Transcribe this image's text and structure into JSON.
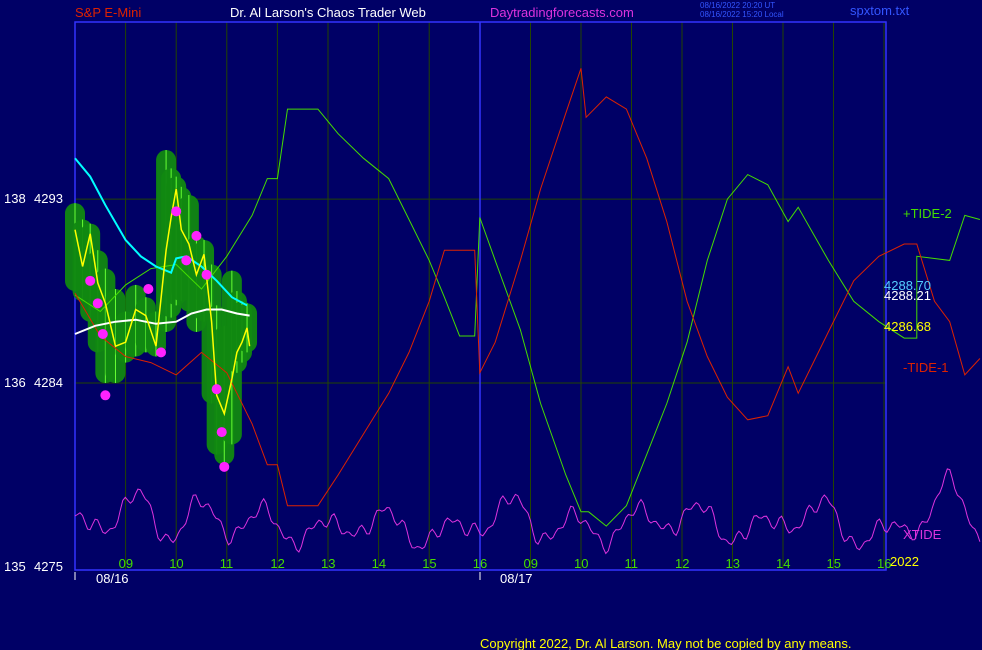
{
  "header": {
    "symbol": "S&P E-Mini",
    "author": "Dr. Al Larson's Chaos Trader Web",
    "site": "Daytradingforecasts.com",
    "timestamp_ut": "08/16/2022 20:20 UT",
    "timestamp_local": "08/16/2022 15:20 Local",
    "file": "spxtom.txt"
  },
  "footer": {
    "copyright": "Copyright 2022, Dr. Al Larson. May not be copied by any means."
  },
  "colors": {
    "background": "#000066",
    "frame": "#3333ff",
    "grid": "#224400",
    "tide_up": "#44dd00",
    "tide_down": "#dd2200",
    "xtide": "#dd33dd",
    "price_bars": "#00cc00",
    "price_line": "#ffff00",
    "ma_fast": "#00ffff",
    "ma_slow": "#ffffff"
  },
  "chart_data": {
    "type": "line",
    "y_axis_labels": [
      {
        "left": "138",
        "right": "4293",
        "value": 4293
      },
      {
        "left": "136",
        "right": "4284",
        "value": 4284
      },
      {
        "left": "135",
        "right": "4275",
        "value": 4275
      }
    ],
    "ylim": [
      4275,
      4294
    ],
    "x_ticks_day1": [
      "09",
      "10",
      "11",
      "12",
      "13",
      "14",
      "15",
      "16"
    ],
    "x_ticks_day2": [
      "09",
      "10",
      "11",
      "12",
      "13",
      "14",
      "15",
      "16"
    ],
    "date_labels": [
      "08/16",
      "08/17"
    ],
    "year_label": "2022",
    "value_labels": [
      {
        "text": "4288.70",
        "value": 4288.7,
        "color": "#55ccff"
      },
      {
        "text": "4288.21",
        "value": 4288.21,
        "color": "#ffffff"
      },
      {
        "text": "4286.68",
        "value": 4286.68,
        "color": "#ffff00"
      }
    ],
    "series_labels": [
      {
        "text": "+TIDE-2",
        "color": "#44dd00"
      },
      {
        "text": "-TIDE-1",
        "color": "#dd2200"
      },
      {
        "text": "XTIDE",
        "color": "#dd33dd"
      }
    ],
    "tide_up": [
      [
        8.0,
        4288.3
      ],
      [
        8.5,
        4287.5
      ],
      [
        9.0,
        4288.8
      ],
      [
        9.5,
        4289.6
      ],
      [
        10.0,
        4289.8
      ],
      [
        10.5,
        4288.6
      ],
      [
        11.0,
        4290.2
      ],
      [
        11.5,
        4292.2
      ],
      [
        11.8,
        4294.0
      ],
      [
        12.0,
        4294.0
      ],
      [
        12.2,
        4297.4
      ],
      [
        12.8,
        4297.4
      ],
      [
        13.2,
        4296.2
      ],
      [
        13.7,
        4295.0
      ],
      [
        14.2,
        4294.0
      ],
      [
        14.6,
        4292.0
      ],
      [
        15.0,
        4290.0
      ],
      [
        15.3,
        4288.2
      ],
      [
        15.6,
        4286.3
      ],
      [
        15.9,
        4286.3
      ],
      [
        16.0,
        4292.1
      ],
      [
        16.3,
        4290.0
      ],
      [
        16.8,
        4286.6
      ],
      [
        17.2,
        4283.0
      ],
      [
        17.7,
        4279.5
      ],
      [
        18.0,
        4277.7
      ],
      [
        18.15,
        4277.7
      ],
      [
        18.5,
        4277.0
      ],
      [
        18.9,
        4278.0
      ],
      [
        19.3,
        4280.5
      ],
      [
        19.7,
        4283.0
      ],
      [
        20.1,
        4286.0
      ],
      [
        20.5,
        4290.0
      ],
      [
        20.9,
        4293.0
      ],
      [
        21.3,
        4294.2
      ],
      [
        21.7,
        4293.7
      ],
      [
        22.1,
        4291.9
      ],
      [
        22.3,
        4292.6
      ],
      [
        22.9,
        4290.0
      ],
      [
        23.4,
        4288.0
      ],
      [
        23.9,
        4287.0
      ],
      [
        24.4,
        4286.2
      ],
      [
        24.65,
        4286.2
      ],
      [
        24.65,
        4290.2
      ],
      [
        25.3,
        4290.0
      ],
      [
        25.6,
        4292.2
      ],
      [
        25.9,
        4292.0
      ]
    ],
    "tide_down": [
      [
        8.0,
        4288.4
      ],
      [
        8.5,
        4286.3
      ],
      [
        9.0,
        4285.3
      ],
      [
        9.5,
        4285.0
      ],
      [
        10.0,
        4284.4
      ],
      [
        10.5,
        4285.5
      ],
      [
        11.0,
        4284.5
      ],
      [
        11.5,
        4282.0
      ],
      [
        11.8,
        4280.0
      ],
      [
        12.0,
        4280.0
      ],
      [
        12.2,
        4278.0
      ],
      [
        12.8,
        4278.0
      ],
      [
        13.2,
        4279.5
      ],
      [
        13.7,
        4281.5
      ],
      [
        14.2,
        4283.5
      ],
      [
        14.6,
        4285.5
      ],
      [
        15.0,
        4288.0
      ],
      [
        15.3,
        4290.5
      ],
      [
        15.9,
        4290.5
      ],
      [
        16.0,
        4284.5
      ],
      [
        16.3,
        4286.0
      ],
      [
        16.8,
        4290.0
      ],
      [
        17.2,
        4293.5
      ],
      [
        17.7,
        4297.2
      ],
      [
        18.0,
        4299.4
      ],
      [
        18.1,
        4297.0
      ],
      [
        18.5,
        4298.0
      ],
      [
        18.9,
        4297.4
      ],
      [
        19.3,
        4295.0
      ],
      [
        19.7,
        4291.9
      ],
      [
        20.1,
        4288.0
      ],
      [
        20.5,
        4285.3
      ],
      [
        20.9,
        4283.3
      ],
      [
        21.3,
        4282.2
      ],
      [
        21.7,
        4282.4
      ],
      [
        22.1,
        4284.8
      ],
      [
        22.3,
        4283.5
      ],
      [
        22.9,
        4286.5
      ],
      [
        23.4,
        4289.0
      ],
      [
        23.9,
        4290.2
      ],
      [
        24.4,
        4290.8
      ],
      [
        24.65,
        4290.8
      ],
      [
        25.0,
        4288.0
      ],
      [
        25.3,
        4287.0
      ],
      [
        25.6,
        4284.4
      ],
      [
        25.9,
        4285.2
      ]
    ],
    "xtide_levels": [
      4277.5,
      4276.8,
      4278.7,
      4276.2,
      4278.3,
      4276.5,
      4277.9,
      4276.1,
      4277.3,
      4276.6,
      4277.8,
      4276.0,
      4277.2,
      4276.7,
      4278.5,
      4276.3,
      4277.6,
      4276.1,
      4277.9,
      4276.8,
      4278.1,
      4276.2,
      4277.4,
      4276.9,
      4278.3,
      4276.0,
      4277.1,
      4276.7,
      4279.4,
      4276.4
    ],
    "price": [
      [
        8.0,
        4291.5
      ],
      [
        8.15,
        4289.7
      ],
      [
        8.3,
        4291.3
      ],
      [
        8.45,
        4288.9
      ],
      [
        8.6,
        4287.9
      ],
      [
        8.8,
        4285.8
      ],
      [
        9.0,
        4286.0
      ],
      [
        9.2,
        4287.6
      ],
      [
        9.4,
        4287.3
      ],
      [
        9.6,
        4285.8
      ],
      [
        9.8,
        4290.5
      ],
      [
        9.9,
        4292.1
      ],
      [
        10.0,
        4293.5
      ],
      [
        10.1,
        4291.5
      ],
      [
        10.25,
        4290.8
      ],
      [
        10.4,
        4289.3
      ],
      [
        10.55,
        4290.3
      ],
      [
        10.7,
        4287.0
      ],
      [
        10.8,
        4283.4
      ],
      [
        10.95,
        4282.5
      ],
      [
        11.1,
        4284.2
      ],
      [
        11.2,
        4285.5
      ],
      [
        11.3,
        4286.0
      ],
      [
        11.4,
        4286.7
      ],
      [
        11.45,
        4285.8
      ]
    ],
    "price_bars": [
      [
        8.0,
        4288.5,
        4292.8
      ],
      [
        8.15,
        4288.0,
        4292.0
      ],
      [
        8.3,
        4287.0,
        4291.8
      ],
      [
        8.45,
        4285.5,
        4290.5
      ],
      [
        8.6,
        4284.0,
        4289.6
      ],
      [
        8.8,
        4284.0,
        4288.6
      ],
      [
        9.0,
        4285.0,
        4287.5
      ],
      [
        9.2,
        4285.3,
        4288.8
      ],
      [
        9.4,
        4285.5,
        4288.2
      ],
      [
        9.6,
        4285.3,
        4287.5
      ],
      [
        9.8,
        4286.5,
        4295.4
      ],
      [
        9.9,
        4287.2,
        4294.5
      ],
      [
        10.0,
        4287.8,
        4294.1
      ],
      [
        10.1,
        4288.0,
        4293.6
      ],
      [
        10.25,
        4287.5,
        4293.2
      ],
      [
        10.4,
        4286.5,
        4291.2
      ],
      [
        10.55,
        4287.0,
        4291.0
      ],
      [
        10.7,
        4283.0,
        4289.8
      ],
      [
        10.8,
        4280.5,
        4287.8
      ],
      [
        10.95,
        4280.0,
        4286.8
      ],
      [
        11.1,
        4281.0,
        4289.5
      ],
      [
        11.2,
        4284.5,
        4288.5
      ],
      [
        11.3,
        4285.0,
        4288.0
      ],
      [
        11.4,
        4285.5,
        4287.9
      ]
    ],
    "markers": [
      [
        8.3,
        4289.0
      ],
      [
        8.45,
        4287.9
      ],
      [
        8.6,
        4283.4
      ],
      [
        8.55,
        4286.4
      ],
      [
        9.45,
        4288.6
      ],
      [
        9.7,
        4285.5
      ],
      [
        10.0,
        4292.4
      ],
      [
        10.2,
        4290.0
      ],
      [
        10.4,
        4291.2
      ],
      [
        10.6,
        4289.3
      ],
      [
        10.8,
        4283.7
      ],
      [
        10.9,
        4281.6
      ],
      [
        10.95,
        4279.9
      ]
    ],
    "ma_fast": [
      [
        8.0,
        4295.0
      ],
      [
        8.3,
        4294.1
      ],
      [
        8.6,
        4292.7
      ],
      [
        9.0,
        4291.0
      ],
      [
        9.3,
        4290.2
      ],
      [
        9.6,
        4289.7
      ],
      [
        9.9,
        4289.4
      ],
      [
        10.0,
        4290.1
      ],
      [
        10.2,
        4290.2
      ],
      [
        10.5,
        4289.7
      ],
      [
        10.8,
        4289.0
      ],
      [
        11.1,
        4288.2
      ],
      [
        11.4,
        4287.8
      ]
    ],
    "ma_slow": [
      [
        8.0,
        4286.4
      ],
      [
        8.4,
        4286.8
      ],
      [
        8.8,
        4287.0
      ],
      [
        9.2,
        4287.1
      ],
      [
        9.6,
        4286.9
      ],
      [
        10.0,
        4287.0
      ],
      [
        10.3,
        4287.4
      ],
      [
        10.6,
        4287.6
      ],
      [
        10.9,
        4287.6
      ],
      [
        11.2,
        4287.4
      ],
      [
        11.45,
        4287.3
      ]
    ]
  }
}
